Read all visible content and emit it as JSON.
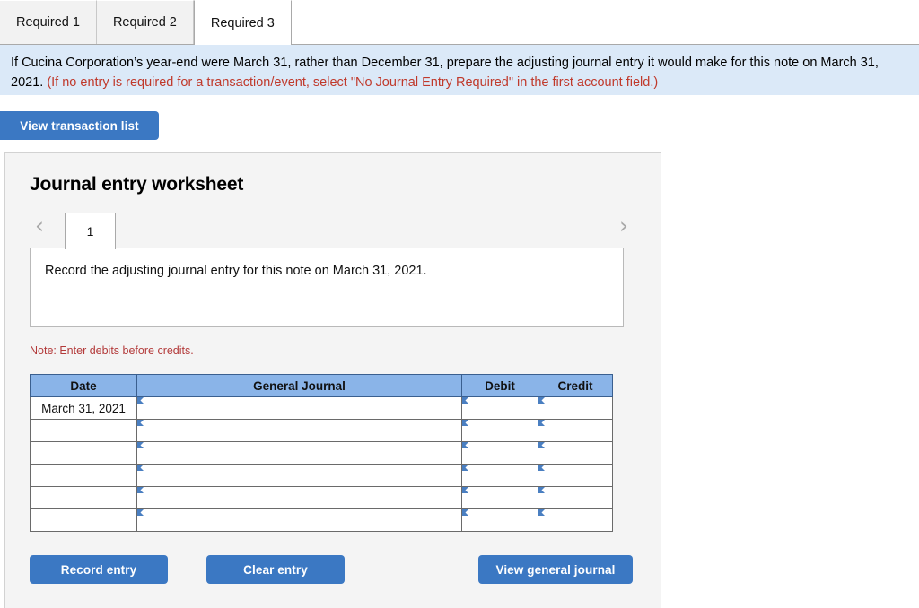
{
  "tabs": [
    {
      "label": "Required 1",
      "active": false
    },
    {
      "label": "Required 2",
      "active": false
    },
    {
      "label": "Required 3",
      "active": true
    }
  ],
  "instruction": {
    "black_text": "If Cucina Corporation’s year-end were March 31, rather than December 31, prepare the adjusting journal entry it would make for this note on March 31, 2021.",
    "red_text": "(If no entry is required for a transaction/event, select \"No Journal Entry Required\" in the first account field.)"
  },
  "toolbar": {
    "view_transaction_list_label": "View transaction list"
  },
  "worksheet": {
    "title": "Journal entry worksheet",
    "prev_icon": "‹",
    "next_icon": "›",
    "page_tab_label": "1",
    "description": "Record the adjusting journal entry for this note on March 31, 2021.",
    "note": "Note: Enter debits before credits."
  },
  "table": {
    "headers": [
      "Date",
      "General Journal",
      "Debit",
      "Credit"
    ],
    "rows": [
      {
        "date": "March 31, 2021",
        "general_journal": "",
        "debit": "",
        "credit": ""
      },
      {
        "date": "",
        "general_journal": "",
        "debit": "",
        "credit": ""
      },
      {
        "date": "",
        "general_journal": "",
        "debit": "",
        "credit": ""
      },
      {
        "date": "",
        "general_journal": "",
        "debit": "",
        "credit": ""
      },
      {
        "date": "",
        "general_journal": "",
        "debit": "",
        "credit": ""
      },
      {
        "date": "",
        "general_journal": "",
        "debit": "",
        "credit": ""
      }
    ]
  },
  "actions": {
    "record_entry_label": "Record entry",
    "clear_entry_label": "Clear entry",
    "view_general_journal_label": "View general journal"
  },
  "colors": {
    "button_blue": "#3b78c3",
    "header_blue": "#8ab4e8",
    "banner_blue": "#dbe9f8",
    "note_red": "#b33a3a",
    "instruction_red": "#c0392b"
  }
}
